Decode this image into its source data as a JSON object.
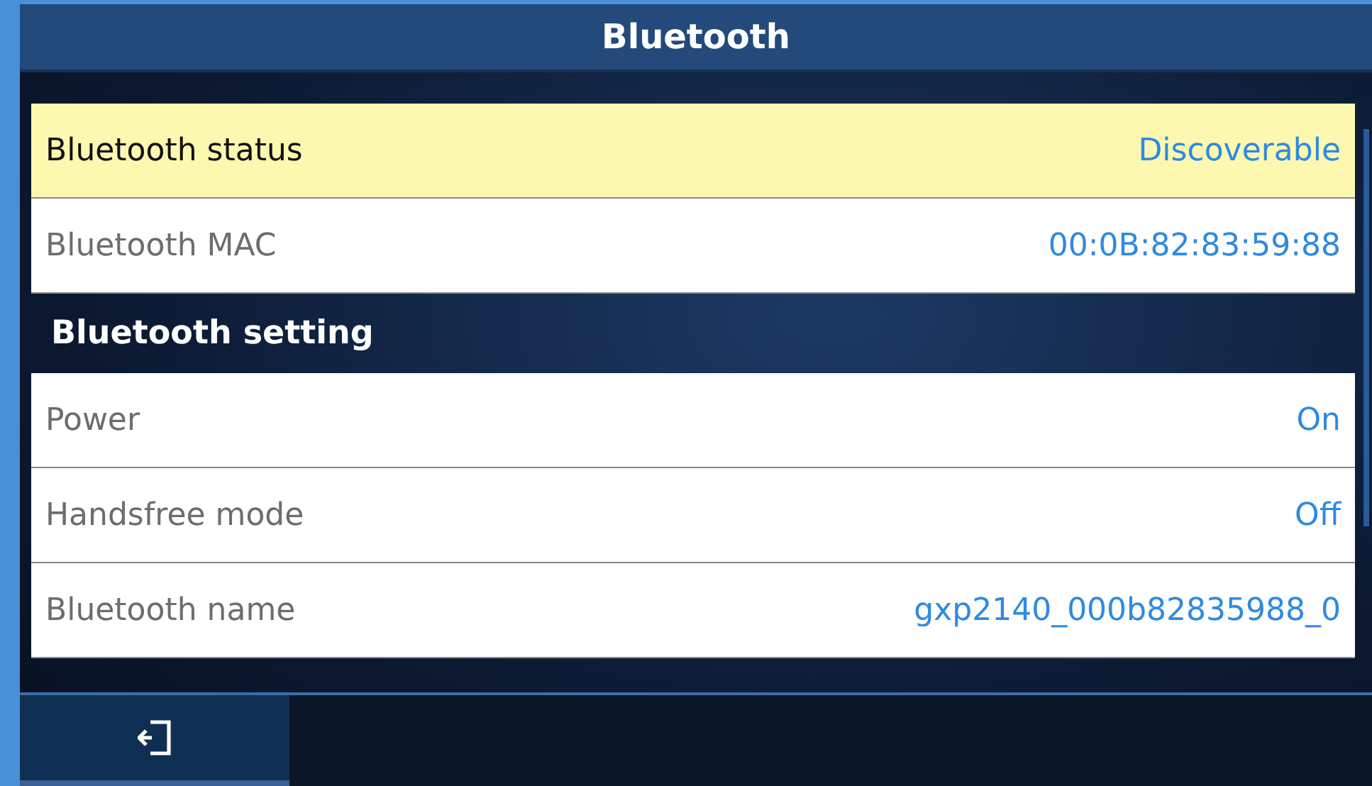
{
  "window": {
    "title": "Bluetooth"
  },
  "items": [
    {
      "kind": "row",
      "label": "Bluetooth status",
      "value": "Discoverable",
      "selected": true
    },
    {
      "kind": "row",
      "label": "Bluetooth MAC",
      "value": "00:0B:82:83:59:88",
      "selected": false
    },
    {
      "kind": "section",
      "label": "Bluetooth setting"
    },
    {
      "kind": "row",
      "label": "Power",
      "value": "On",
      "selected": false
    },
    {
      "kind": "row",
      "label": "Handsfree mode",
      "value": "Off",
      "selected": false
    },
    {
      "kind": "row",
      "label": "Bluetooth name",
      "value": "gxp2140_000b82835988_0",
      "selected": false
    }
  ],
  "softkeys": [
    {
      "kind": "exit",
      "selected": true
    }
  ]
}
